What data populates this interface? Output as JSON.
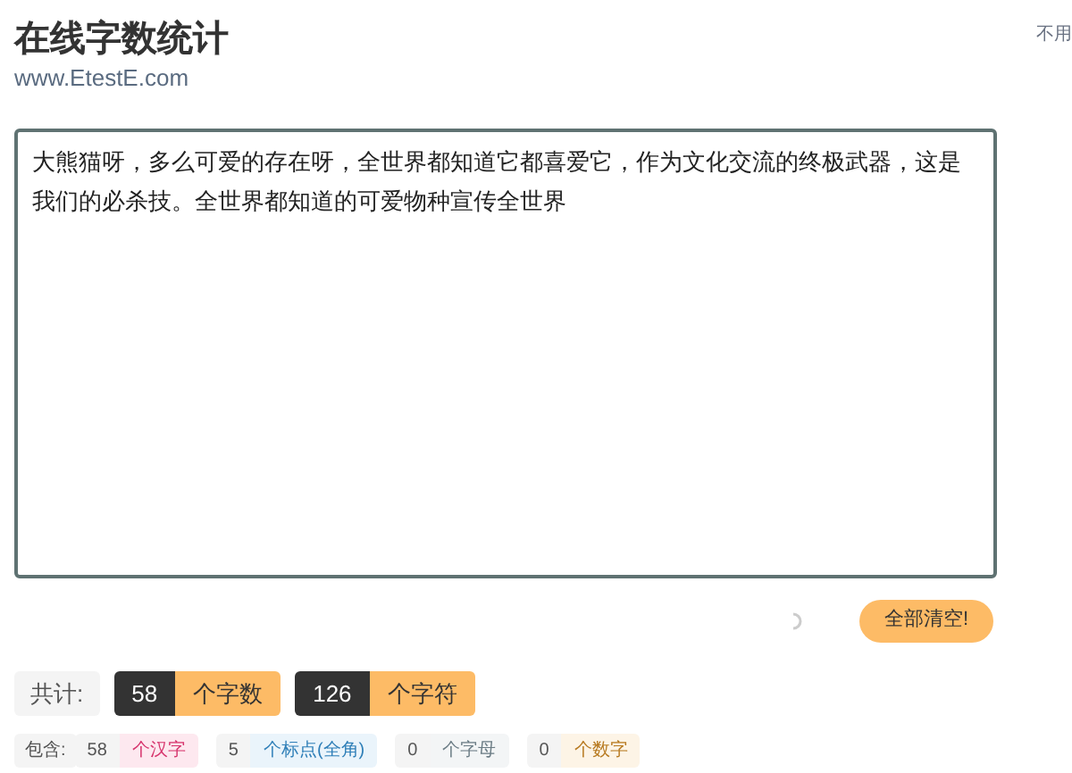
{
  "title": "在线字数统计",
  "subtitle": "www.EtestE.com",
  "side_note": "不用",
  "editor": {
    "value": "大熊猫呀，多么可爱的存在呀，全世界都知道它都喜爱它，作为文化交流的终极武器，这是我们的必杀技。全世界都知道的可爱物种宣传全世界"
  },
  "clear_button": "全部清空!",
  "totals": {
    "label": "共计:",
    "items": [
      {
        "count": "58",
        "unit": "个字数"
      },
      {
        "count": "126",
        "unit": "个字符"
      }
    ]
  },
  "breakdown": {
    "label": "包含:",
    "items": [
      {
        "count": "58",
        "unit": "个汉字",
        "color": "#d6336c"
      },
      {
        "count": "5",
        "unit": "个标点(全角)",
        "color": "#2f7fb8"
      },
      {
        "count": "0",
        "unit": "个字母",
        "color": "#6b7c85"
      },
      {
        "count": "0",
        "unit": "个数字",
        "color": "#b7791f"
      }
    ]
  }
}
